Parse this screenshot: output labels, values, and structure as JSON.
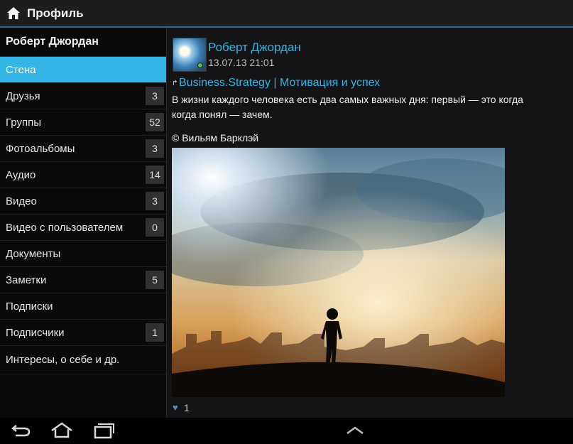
{
  "actionbar": {
    "title": "Профиль",
    "home_icon": "home-icon"
  },
  "sidebar": {
    "header": "Роберт Джордан",
    "items": [
      {
        "label": "Стена",
        "count": "",
        "active": true
      },
      {
        "label": "Друзья",
        "count": "3"
      },
      {
        "label": "Группы",
        "count": "52"
      },
      {
        "label": "Фотоальбомы",
        "count": "3"
      },
      {
        "label": "Аудио",
        "count": "14"
      },
      {
        "label": "Видео",
        "count": "3"
      },
      {
        "label": "Видео с пользователем",
        "count": "0"
      },
      {
        "label": "Документы",
        "count": ""
      },
      {
        "label": "Заметки",
        "count": "5"
      },
      {
        "label": "Подписки",
        "count": ""
      },
      {
        "label": "Подписчики",
        "count": "1"
      },
      {
        "label": "Интересы, о себе и др.",
        "count": ""
      }
    ]
  },
  "post": {
    "author": "Роберт Джордан",
    "date": "13.07.13 21:01",
    "repost_source": "Business.Strategy | Мотивация и успех",
    "text_line1": "В жизни каждого человека есть два самых важных дня: первый — это когда",
    "text_line2": "когда понял — зачем.",
    "quote": "© Вильям Барклэй",
    "likes": "1"
  },
  "colors": {
    "accent": "#33b5e5",
    "background": "#141416",
    "sidebar": "#0a0a0b"
  },
  "navbar": {
    "icons": [
      "back-icon",
      "home-nav-icon",
      "recent-apps-icon",
      "chevron-up-icon"
    ]
  }
}
